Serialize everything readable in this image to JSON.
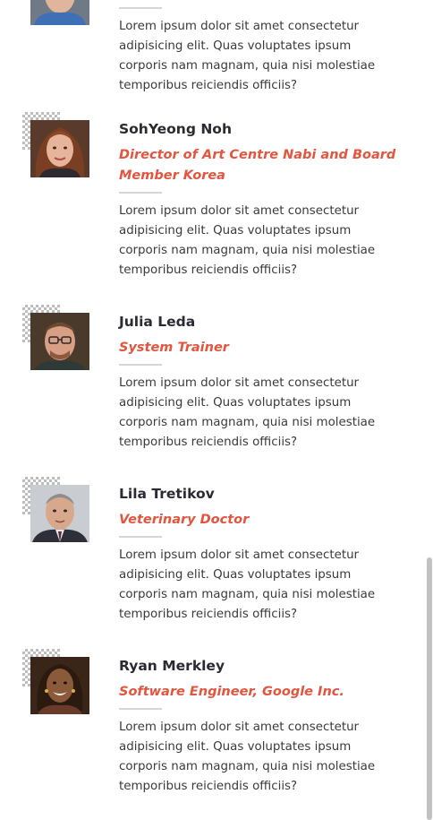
{
  "speakers": [
    {
      "name": "",
      "role": "",
      "bio": "Lorem ipsum dolor sit amet consectetur adipisicing elit. Quas voluptates ipsum corporis nam magnam, quia nisi molestiae temporibus reiciendis officiis?",
      "photo": "avatar-man-blue-shirt"
    },
    {
      "name": "SohYeong Noh",
      "role": "Director of Art Centre Nabi and Board Member Korea",
      "bio": "Lorem ipsum dolor sit amet consectetur adipisicing elit. Quas voluptates ipsum corporis nam magnam, quia nisi molestiae temporibus reiciendis officiis?",
      "photo": "avatar-woman-brown-hair"
    },
    {
      "name": "Julia Leda",
      "role": "System Trainer",
      "bio": "Lorem ipsum dolor sit amet consectetur adipisicing elit. Quas voluptates ipsum corporis nam magnam, quia nisi molestiae temporibus reiciendis officiis?",
      "photo": "avatar-man-glasses"
    },
    {
      "name": "Lila Tretikov",
      "role": "Veterinary Doctor",
      "bio": "Lorem ipsum dolor sit amet consectetur adipisicing elit. Quas voluptates ipsum corporis nam magnam, quia nisi molestiae temporibus reiciendis officiis?",
      "photo": "avatar-man-suit"
    },
    {
      "name": "Ryan Merkley",
      "role": "Software Engineer, Google Inc.",
      "bio": "Lorem ipsum dolor sit amet consectetur adipisicing elit. Quas voluptates ipsum corporis nam magnam, quia nisi molestiae temporibus reiciendis officiis?",
      "photo": "avatar-woman-smiling"
    }
  ],
  "colors": {
    "accent": "#e2553f",
    "name": "#2a2a33",
    "text": "#3a3a3a",
    "rule": "#d6d6d6"
  }
}
